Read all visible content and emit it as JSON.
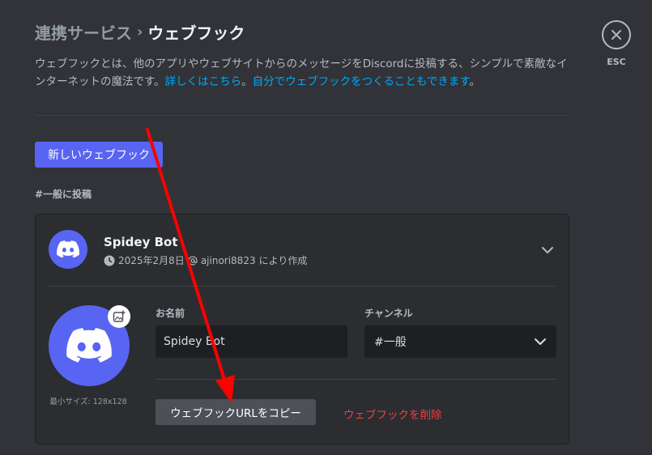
{
  "breadcrumb": {
    "parent": "連携サービス",
    "separator": "›",
    "current": "ウェブフック"
  },
  "close": {
    "label": "ESC"
  },
  "description": {
    "text": "ウェブフックとは、他のアプリやウェブサイトからのメッセージをDiscordに投稿する、シンプルで素敵なインターネットの魔法です。",
    "learn_more": "詳しくはこちら",
    "period": "。",
    "make_own": "自分でウェブフックをつくることもできます",
    "end": "。"
  },
  "new_webhook_button": "新しいウェブフック",
  "section_label": "#一般に投稿",
  "webhook": {
    "name": "Spidey Bot",
    "created_date": "2025年2月8日",
    "created_by": "ajinori8823",
    "created_suffix": "により作成",
    "min_size": "最小サイズ: 128x128",
    "name_label": "お名前",
    "name_value": "Spidey Bot",
    "channel_label": "チャンネル",
    "channel_value": "#一般",
    "copy_url_button": "ウェブフックURLをコピー",
    "delete_link": "ウェブフックを削除"
  },
  "colors": {
    "accent": "#5865f2",
    "danger": "#f23f43",
    "link": "#00a8fc",
    "annotation_arrow": "#ff0000"
  },
  "icons": [
    "close-icon",
    "discord-logo-icon",
    "clock-icon",
    "at-icon",
    "chevron-down-icon",
    "image-upload-icon"
  ]
}
